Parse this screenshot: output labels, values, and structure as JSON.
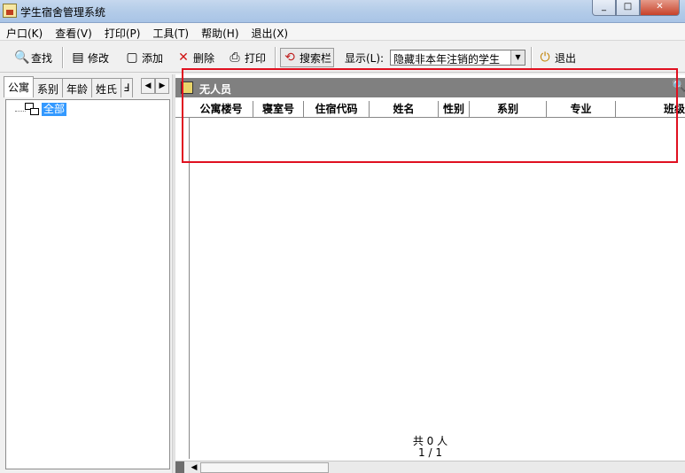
{
  "window": {
    "title": "学生宿舍管理系统",
    "minimize": "_",
    "maximize": "□",
    "close": "✕"
  },
  "menu": [
    "户口(K)",
    "查看(V)",
    "打印(P)",
    "工具(T)",
    "帮助(H)",
    "退出(X)"
  ],
  "toolbar": {
    "find": "查找",
    "edit": "修改",
    "add": "添加",
    "delete": "删除",
    "print": "打印",
    "search_bar": "搜索栏",
    "display_label": "显示(L):",
    "display_value": "隐藏非本年注销的学生",
    "exit": "退出"
  },
  "tabs": [
    "公寓",
    "系别",
    "年龄",
    "姓氏",
    "Ⅎ"
  ],
  "tab_arrows": {
    "left": "◀",
    "right": "▶"
  },
  "tree": {
    "root_label": "全部"
  },
  "grid": {
    "title": "无人员",
    "columns": [
      "公寓楼号",
      "寝室号",
      "住宿代码",
      "姓名",
      "性别",
      "系别",
      "专业",
      "班级"
    ]
  },
  "footer": {
    "count": "共 0 人",
    "page": "1 / 1"
  },
  "colors": {
    "highlight": "#e01020",
    "selection": "#3399ff",
    "panel_header": "#808080"
  },
  "icons": {
    "find": "🔍",
    "edit": "▤",
    "add": "▢",
    "delete": "✕",
    "print": "⎙",
    "search_bar": "⟲",
    "exit": "⏻",
    "dropdown": "▼",
    "grid_search": "🔍"
  }
}
